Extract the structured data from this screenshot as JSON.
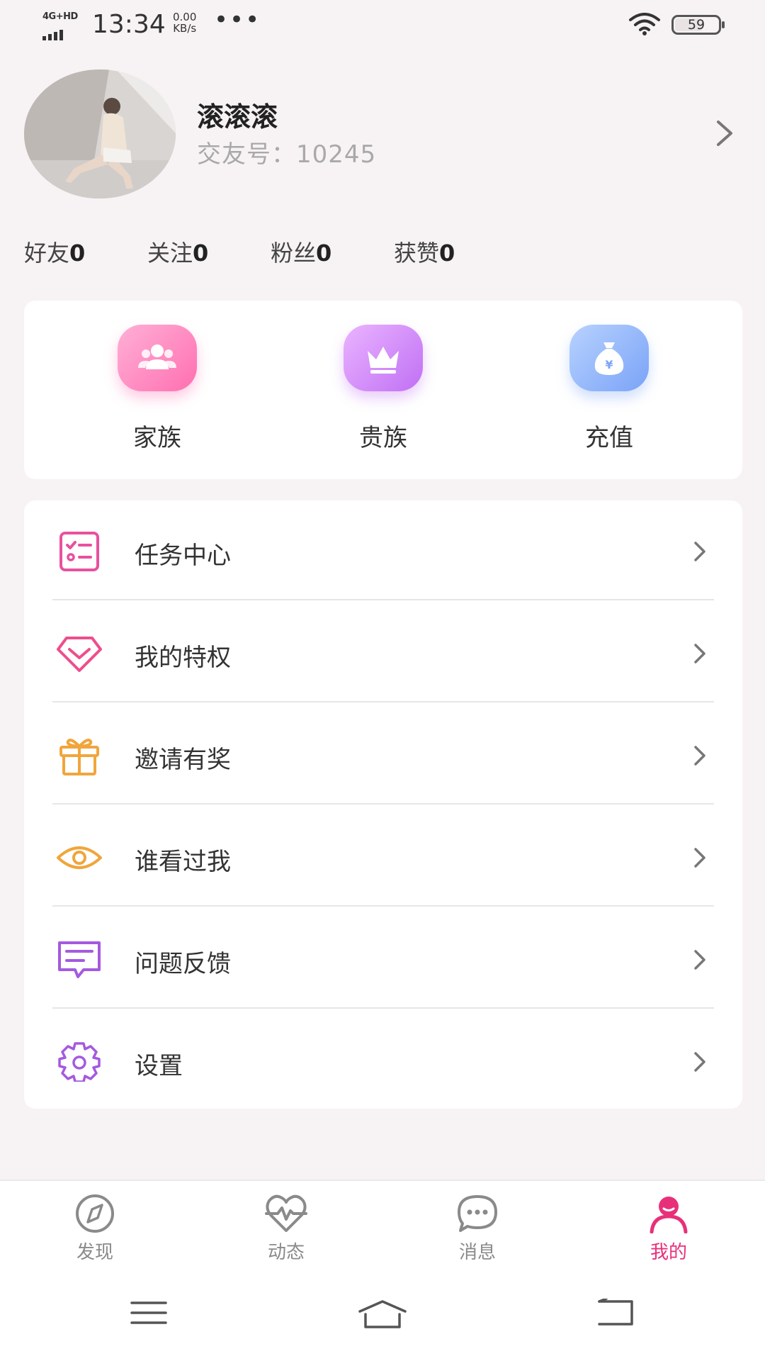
{
  "status_bar": {
    "network": "4G+HD",
    "time": "13:34",
    "speed_value": "0.00",
    "speed_unit": "KB/s",
    "more": "•••",
    "battery": "59"
  },
  "profile": {
    "name": "滚滚滚",
    "id_label": "交友号：",
    "id_value": "10245"
  },
  "stats": [
    {
      "label": "好友",
      "value": "0"
    },
    {
      "label": "关注",
      "value": "0"
    },
    {
      "label": "粉丝",
      "value": "0"
    },
    {
      "label": "获赞",
      "value": "0"
    }
  ],
  "quick_actions": [
    {
      "label": "家族",
      "icon": "users-icon",
      "color_from": "#ff9ccd",
      "color_to": "#ff6fb1"
    },
    {
      "label": "贵族",
      "icon": "crown-icon",
      "color_from": "#e4a8ff",
      "color_to": "#c070f4"
    },
    {
      "label": "充值",
      "icon": "money-bag-icon",
      "color_from": "#a9c8ff",
      "color_to": "#7aa3f7"
    }
  ],
  "menu": [
    {
      "label": "任务中心",
      "icon": "task-list-icon",
      "color": "#e8519e"
    },
    {
      "label": "我的特权",
      "icon": "diamond-icon",
      "color": "#ee4e8c"
    },
    {
      "label": "邀请有奖",
      "icon": "gift-icon",
      "color": "#f0a63c"
    },
    {
      "label": "谁看过我",
      "icon": "eye-icon",
      "color": "#f0a63c"
    },
    {
      "label": "问题反馈",
      "icon": "feedback-icon",
      "color": "#a45ae0"
    },
    {
      "label": "设置",
      "icon": "gear-icon",
      "color": "#a45ae0"
    }
  ],
  "tabs": [
    {
      "label": "发现",
      "icon": "compass-icon"
    },
    {
      "label": "动态",
      "icon": "heartbeat-icon"
    },
    {
      "label": "消息",
      "icon": "chat-icon"
    },
    {
      "label": "我的",
      "icon": "person-icon",
      "active": true
    }
  ],
  "colors": {
    "accent": "#e8307a",
    "background": "#f7f3f4",
    "inactive_tab": "#8a8a8a"
  }
}
